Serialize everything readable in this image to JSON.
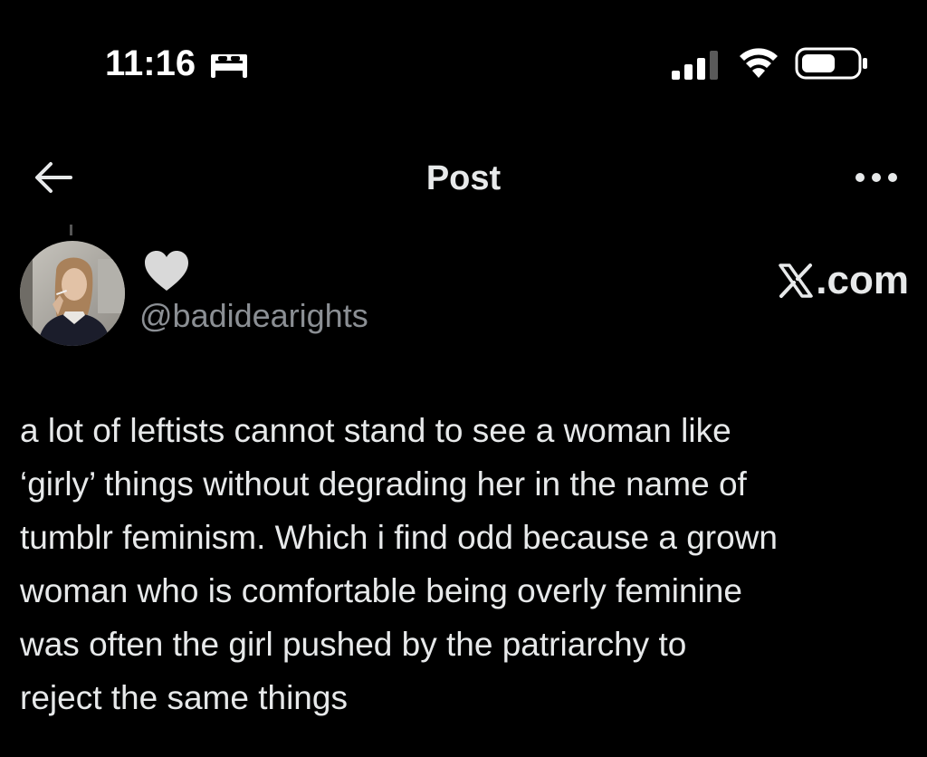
{
  "status_bar": {
    "time": "11:16",
    "icons": [
      "bed-icon",
      "cellular-signal-icon",
      "wifi-icon",
      "battery-icon"
    ]
  },
  "nav": {
    "title": "Post",
    "back_icon": "back-arrow-icon",
    "more_icon": "more-options-icon"
  },
  "author": {
    "display_name_icon": "grey-heart-icon",
    "handle": "@badidearights"
  },
  "site_badge": {
    "text": ".com",
    "logo": "x-logo-icon"
  },
  "post": {
    "lines": [
      "a lot of leftists cannot stand to see a woman like",
      "‘girly’ things without degrading her in the name of",
      "tumblr feminism. Which i find odd because a grown",
      "woman who is comfortable being overly feminine",
      "was often the girl pushed by the patriarchy to",
      "reject the same things"
    ]
  },
  "colors": {
    "background": "#000000",
    "text_primary": "#e7e9ea",
    "text_secondary": "#8b8f94",
    "heart": "#d9d9d9"
  }
}
